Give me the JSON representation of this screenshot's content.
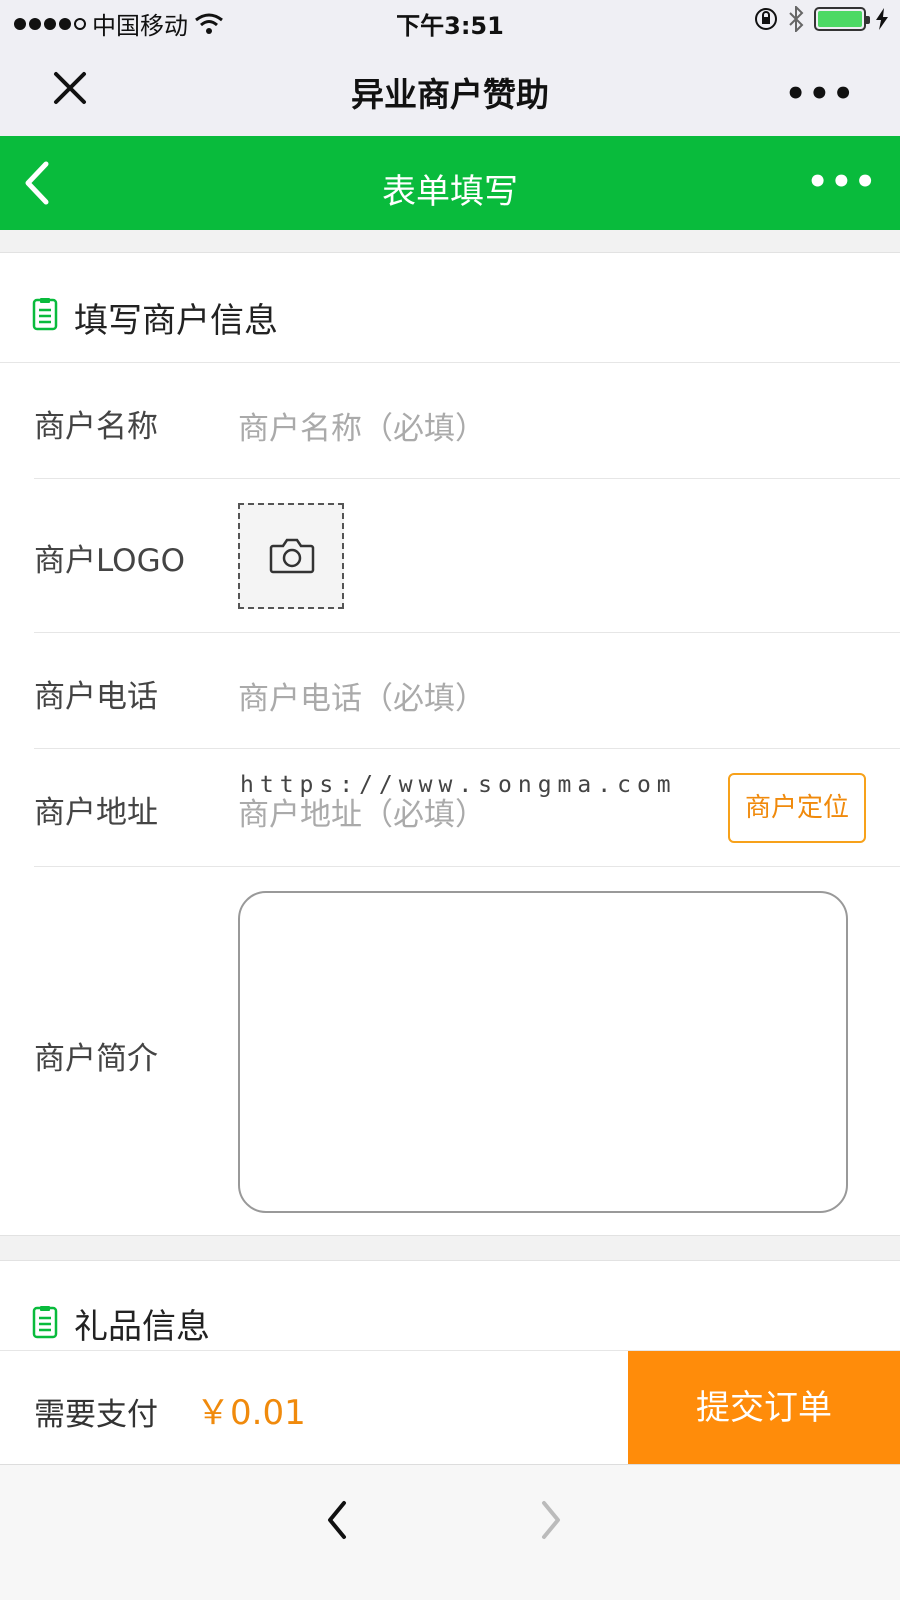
{
  "status_bar": {
    "carrier": "中国移动",
    "time": "下午3:51"
  },
  "wechat_bar": {
    "title": "异业商户赞助",
    "more": "•••"
  },
  "nav": {
    "title": "表单填写",
    "more": "•••"
  },
  "merchant_section": {
    "title": "填写商户信息",
    "fields": {
      "name_label": "商户名称",
      "name_placeholder": "商户名称（必填）",
      "logo_label": "商户LOGO",
      "phone_label": "商户电话",
      "phone_placeholder": "商户电话（必填）",
      "address_label": "商户地址",
      "address_placeholder": "商户地址（必填）",
      "locate_button": "商户定位",
      "intro_label": "商户简介"
    }
  },
  "watermark": "https://www.songma.com",
  "gift_section": {
    "title": "礼品信息"
  },
  "payment": {
    "label": "需要支付",
    "amount": "￥0.01",
    "submit": "提交订单"
  },
  "colors": {
    "accent_green": "#09bb3c",
    "accent_orange": "#ff8c0a"
  }
}
